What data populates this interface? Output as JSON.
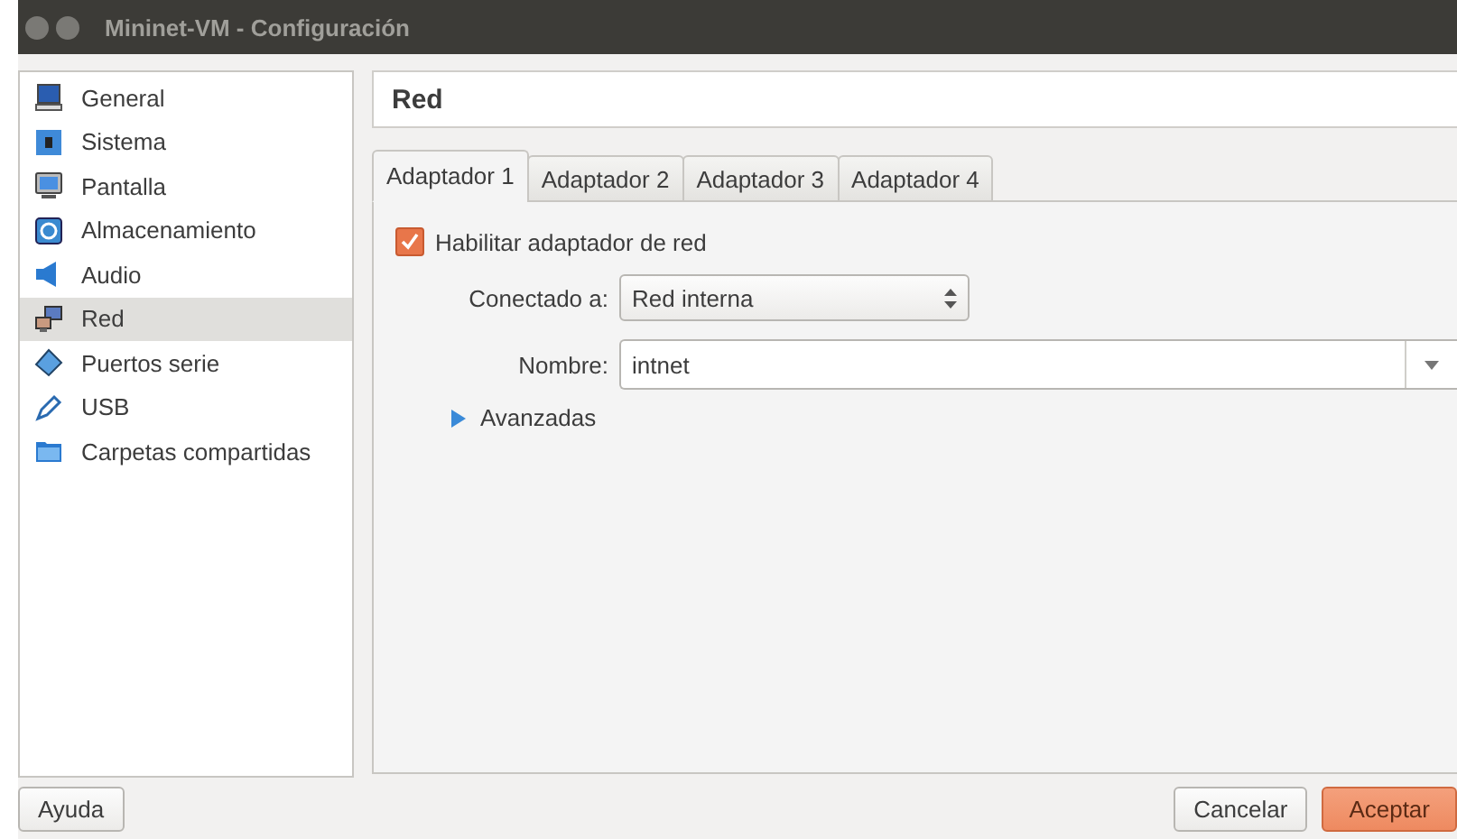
{
  "window": {
    "title": "Mininet-VM - Configuración"
  },
  "sidebar": {
    "items": [
      {
        "label": "General",
        "kind": "monitor",
        "selected": false
      },
      {
        "label": "Sistema",
        "kind": "chip",
        "selected": false
      },
      {
        "label": "Pantalla",
        "kind": "display",
        "selected": false
      },
      {
        "label": "Almacenamiento",
        "kind": "storage",
        "selected": false
      },
      {
        "label": "Audio",
        "kind": "speaker",
        "selected": false
      },
      {
        "label": "Red",
        "kind": "network",
        "selected": true
      },
      {
        "label": "Puertos serie",
        "kind": "serial",
        "selected": false
      },
      {
        "label": "USB",
        "kind": "usb",
        "selected": false
      },
      {
        "label": "Carpetas compartidas",
        "kind": "folder",
        "selected": false
      }
    ]
  },
  "section_title": "Red",
  "tabs": [
    {
      "label": "Adaptador 1",
      "selected": true
    },
    {
      "label": "Adaptador 2",
      "selected": false
    },
    {
      "label": "Adaptador 3",
      "selected": false
    },
    {
      "label": "Adaptador 4",
      "selected": false
    }
  ],
  "enable_adapter": {
    "label": "Habilitar adaptador de red",
    "checked": true
  },
  "attached_to": {
    "label": "Conectado a:",
    "value": "Red interna"
  },
  "name": {
    "label": "Nombre:",
    "value": "intnet"
  },
  "advanced": {
    "label": "Avanzadas",
    "expanded": false
  },
  "buttons": {
    "help": "Ayuda",
    "cancel": "Cancelar",
    "accept": "Aceptar"
  }
}
